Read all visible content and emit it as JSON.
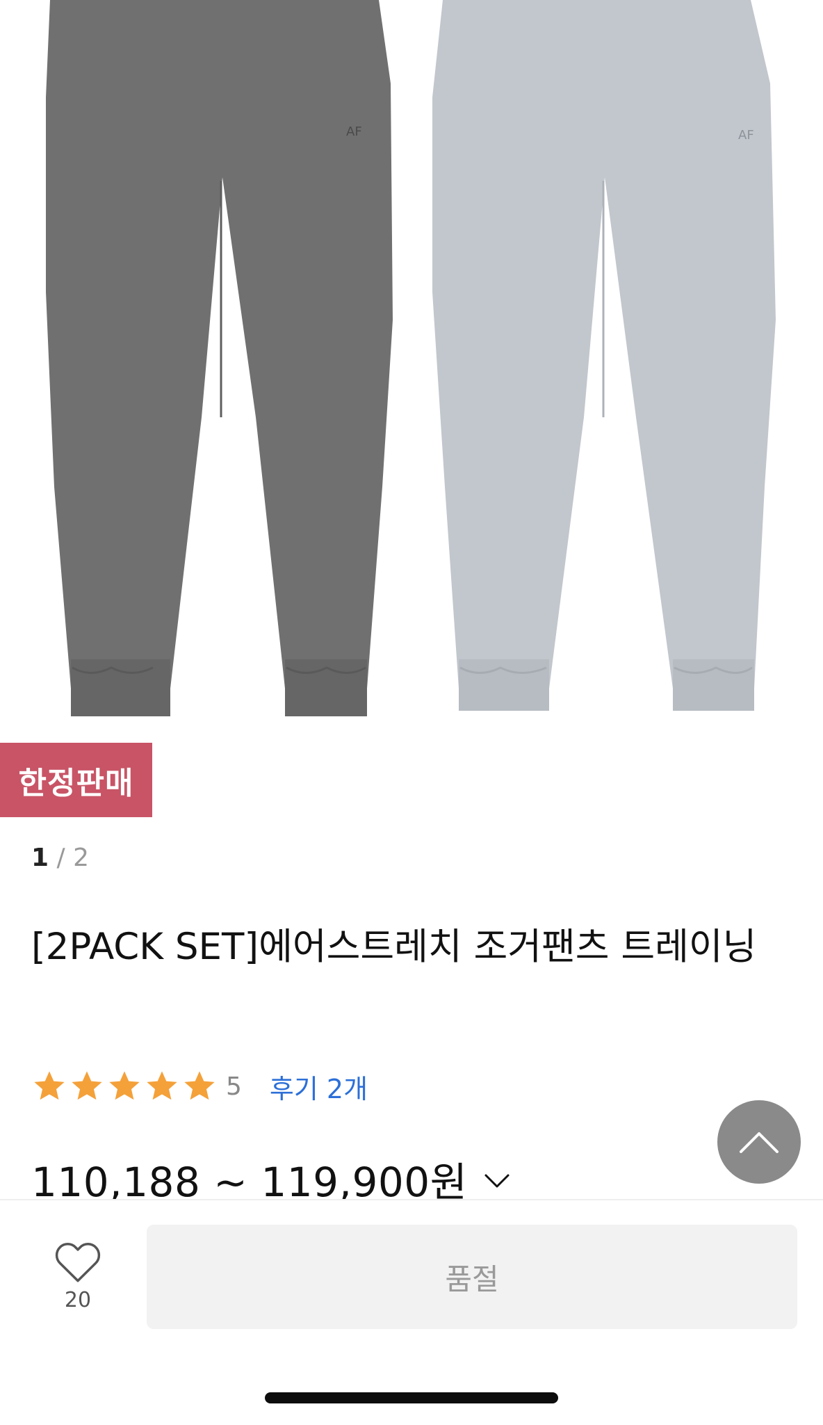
{
  "product": {
    "badge": "한정판매",
    "pager": {
      "current": "1",
      "separator": "/",
      "total": "2"
    },
    "title": "[2PACK SET]에어스트레치 조거팬츠 트레이닝",
    "rating": {
      "score": "5",
      "stars": 5,
      "reviews_link": "후기 2개"
    },
    "price_range": "110,188 ~ 119,900원",
    "image": {
      "left_color": "#707070",
      "right_color": "#c2c7cd"
    }
  },
  "bottom_bar": {
    "wishlist_count": "20",
    "buy_button_label": "품절"
  },
  "colors": {
    "badge_bg": "#c85466",
    "star": "#f4a13a",
    "link": "#2c6fd8",
    "scroll_top_bg": "#8a8a8a"
  }
}
